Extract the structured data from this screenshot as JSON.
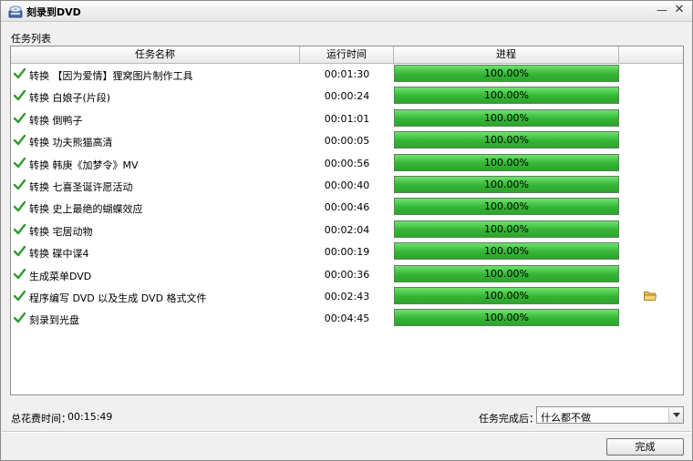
{
  "window": {
    "title": "刻录到DVD",
    "min_symbol": "—",
    "close_symbol": "✕"
  },
  "task_list": {
    "label": "任务列表",
    "columns": {
      "name": "任务名称",
      "time": "运行时间",
      "progress": "进程",
      "extra": ""
    },
    "rows": [
      {
        "name": "转换 【因为爱情】狸窝图片制作工具",
        "time": "00:01:30",
        "progress_text": "100.00%",
        "progress": 1.0
      },
      {
        "name": "转换 白娘子(片段)",
        "time": "00:00:24",
        "progress_text": "100.00%",
        "progress": 1.0
      },
      {
        "name": "转换 倒鸭子",
        "time": "00:01:01",
        "progress_text": "100.00%",
        "progress": 1.0
      },
      {
        "name": "转换 功夫熊猫高清",
        "time": "00:00:05",
        "progress_text": "100.00%",
        "progress": 1.0
      },
      {
        "name": "转换 韩庚《加梦令》MV",
        "time": "00:00:56",
        "progress_text": "100.00%",
        "progress": 1.0
      },
      {
        "name": "转换 七喜圣诞许愿活动",
        "time": "00:00:40",
        "progress_text": "100.00%",
        "progress": 1.0
      },
      {
        "name": "转换 史上最绝的蝴蝶效应",
        "time": "00:00:46",
        "progress_text": "100.00%",
        "progress": 1.0
      },
      {
        "name": "转换 宅居动物",
        "time": "00:02:04",
        "progress_text": "100.00%",
        "progress": 1.0
      },
      {
        "name": "转换 碟中谍4",
        "time": "00:00:19",
        "progress_text": "100.00%",
        "progress": 1.0
      },
      {
        "name": "生成菜单DVD",
        "time": "00:00:36",
        "progress_text": "100.00%",
        "progress": 1.0
      },
      {
        "name": "程序编写 DVD 以及生成 DVD 格式文件",
        "time": "00:02:43",
        "progress_text": "100.00%",
        "progress": 1.0,
        "has_folder": true
      },
      {
        "name": "刻录到光盘",
        "time": "00:04:45",
        "progress_text": "100.00%",
        "progress": 1.0
      }
    ]
  },
  "footer": {
    "total_label": "总花费时间：",
    "total_value": "00:15:49",
    "after_label": "任务完成后：",
    "after_value": "什么都不做",
    "done_label": "完成"
  },
  "colors": {
    "progress_fill": "#35b535",
    "check": "#2f9a2f",
    "folder": "#e8b84a"
  },
  "icons": {
    "status": "check-icon",
    "open_folder": "folder-icon",
    "dropdown": "chevron-down-icon",
    "app": "dvd-burner-icon"
  }
}
